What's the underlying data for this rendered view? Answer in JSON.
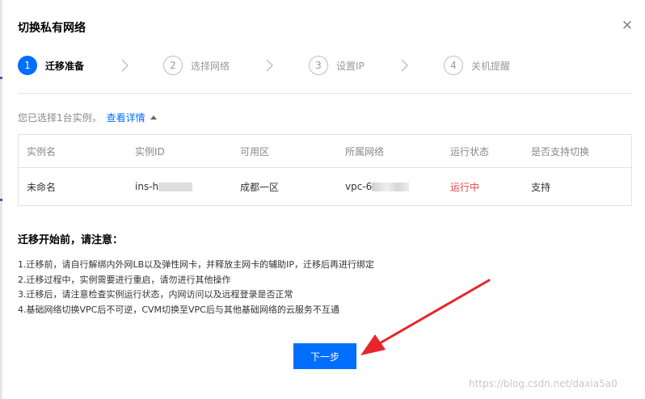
{
  "dialog": {
    "title": "切换私有网络",
    "close_glyph": "✕"
  },
  "steps": [
    {
      "number": "1",
      "label": "迁移准备",
      "active": true
    },
    {
      "number": "2",
      "label": "选择网络",
      "active": false
    },
    {
      "number": "3",
      "label": "设置IP",
      "active": false
    },
    {
      "number": "4",
      "label": "关机提醒",
      "active": false
    }
  ],
  "selection": {
    "text": "您已选择1台实例，",
    "detail_link": "查看详情"
  },
  "table": {
    "columns": [
      "实例名",
      "实例ID",
      "可用区",
      "所属网络",
      "运行状态",
      "是否支持切换"
    ],
    "rows": [
      {
        "name": "未命名",
        "id_prefix": "ins-h",
        "zone": "成都一区",
        "vpc_prefix": "vpc-6",
        "status": "运行中",
        "supported": "支持"
      }
    ],
    "status_color": "#e54545"
  },
  "notice": {
    "title": "迁移开始前，请注意：",
    "items": [
      "1.迁移前，请自行解绑内外网LB以及弹性网卡，并释放主网卡的辅助IP，迁移后再进行绑定",
      "2.迁移过程中，实例需要进行重启，请勿进行其他操作",
      "3.迁移后，请注意检查实例运行状态，内网访问以及远程登录是否正常",
      "4.基础网络切换VPC后不可逆，CVM切换至VPC后与其他基础网络的云服务不互通"
    ]
  },
  "buttons": {
    "next": "下一步"
  },
  "watermark": "https://blog.csdn.net/daxia5a0",
  "colors": {
    "primary": "#006eff",
    "annotation_arrow": "#e8252b"
  },
  "icons": {
    "close": "close-icon",
    "step_separator": "chevron-right-icon",
    "collapse": "caret-up-icon"
  }
}
